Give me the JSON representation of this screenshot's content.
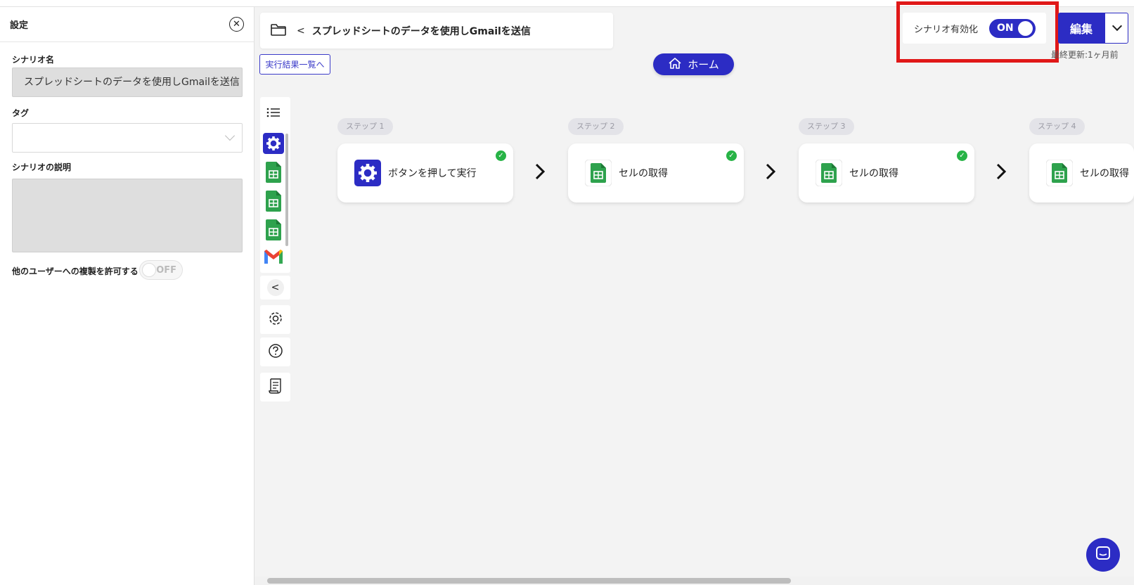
{
  "settings": {
    "title": "設定",
    "name_label": "シナリオ名",
    "name_value": "スプレッドシートのデータを使用しGmailを送信",
    "tag_label": "タグ",
    "tag_value": "",
    "description_label": "シナリオの説明",
    "description_value": "",
    "duplicate_label": "他のユーザーへの複製を許可する",
    "duplicate_toggle": "OFF"
  },
  "header": {
    "breadcrumb_back": "<",
    "scenario_title": "スプレッドシートのデータを使用しGmailを送信",
    "results_link": "実行結果一覧へ",
    "home_button": "ホーム",
    "scenario_enable_label": "シナリオ有効化",
    "scenario_enable_toggle": "ON",
    "edit_button": "編集",
    "last_updated": "最終更新:1ヶ月前"
  },
  "steps": [
    {
      "pill": "ステップ 1",
      "label": "ボタンを押して実行",
      "icon": "gear-icon",
      "done": "✓"
    },
    {
      "pill": "ステップ 2",
      "label": "セルの取得",
      "icon": "google-sheets-icon",
      "done": "✓"
    },
    {
      "pill": "ステップ 3",
      "label": "セルの取得",
      "icon": "google-sheets-icon",
      "done": "✓"
    },
    {
      "pill": "ステップ 4",
      "label": "セルの取得",
      "icon": "google-sheets-icon",
      "done": ""
    }
  ],
  "toolbar": {
    "collapse": "<"
  },
  "colors": {
    "accent": "#2c2cc4",
    "success": "#27b346",
    "highlight": "#e01818",
    "sheets_green": "#2ea24d"
  }
}
